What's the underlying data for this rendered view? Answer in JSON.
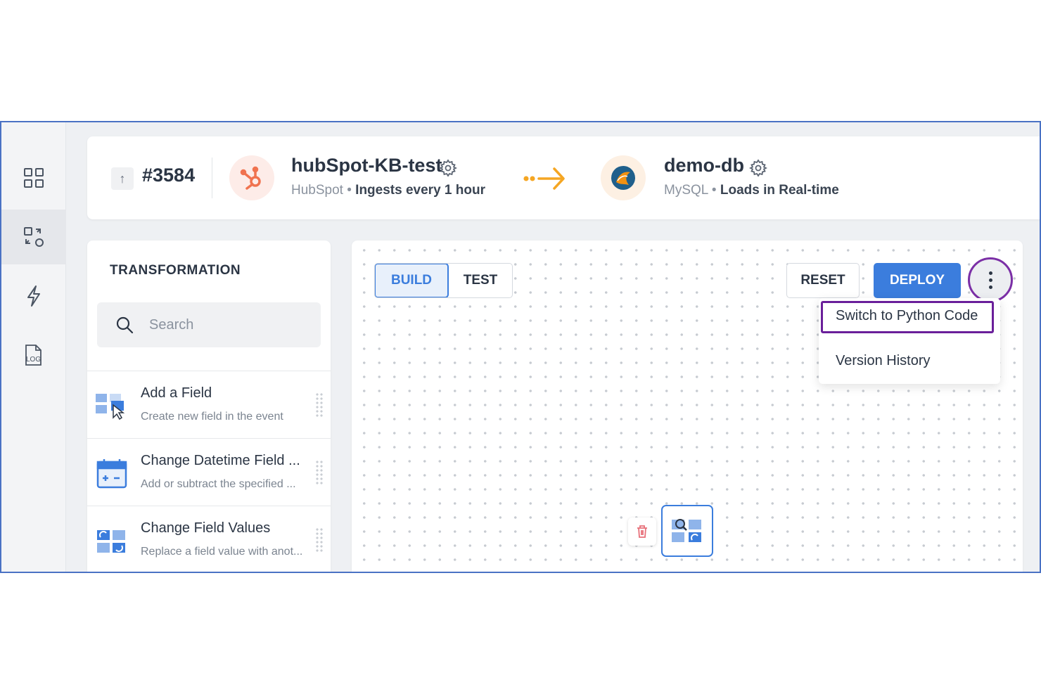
{
  "rail": {
    "items": [
      {
        "icon": "dashboard-grid-icon"
      },
      {
        "icon": "transform-icon",
        "active": true
      },
      {
        "icon": "lightning-icon"
      },
      {
        "icon": "log-file-icon",
        "label": "LOG"
      }
    ]
  },
  "header": {
    "pipeline_id": "#3584",
    "source": {
      "name": "hubSpot-KB-test",
      "type": "HubSpot",
      "schedule": "Ingests every 1 hour",
      "separator": "•"
    },
    "destination": {
      "name": "demo-db",
      "type": "MySQL",
      "schedule": "Loads in Real-time",
      "separator": "•"
    },
    "colors": {
      "accent": "#3b7ddd",
      "hubspot": "#f0734f",
      "arrow": "#f5a623"
    }
  },
  "panel": {
    "title": "TRANSFORMATION",
    "search_placeholder": "Search",
    "items": [
      {
        "name": "Add a Field",
        "description": "Create new field in the event",
        "icon": "add-field-icon"
      },
      {
        "name": "Change Datetime Field ...",
        "description": "Add or subtract the specified ...",
        "icon": "calendar-icon"
      },
      {
        "name": "Change Field Values",
        "description": "Replace a field value with anot...",
        "icon": "change-values-icon"
      }
    ]
  },
  "canvas": {
    "tabs": {
      "build": "BUILD",
      "test": "TEST",
      "active": "BUILD"
    },
    "reset_label": "RESET",
    "deploy_label": "DEPLOY",
    "menu": {
      "items": [
        "Switch to Python Code",
        "Version History"
      ],
      "highlighted": "Switch to Python Code"
    }
  }
}
